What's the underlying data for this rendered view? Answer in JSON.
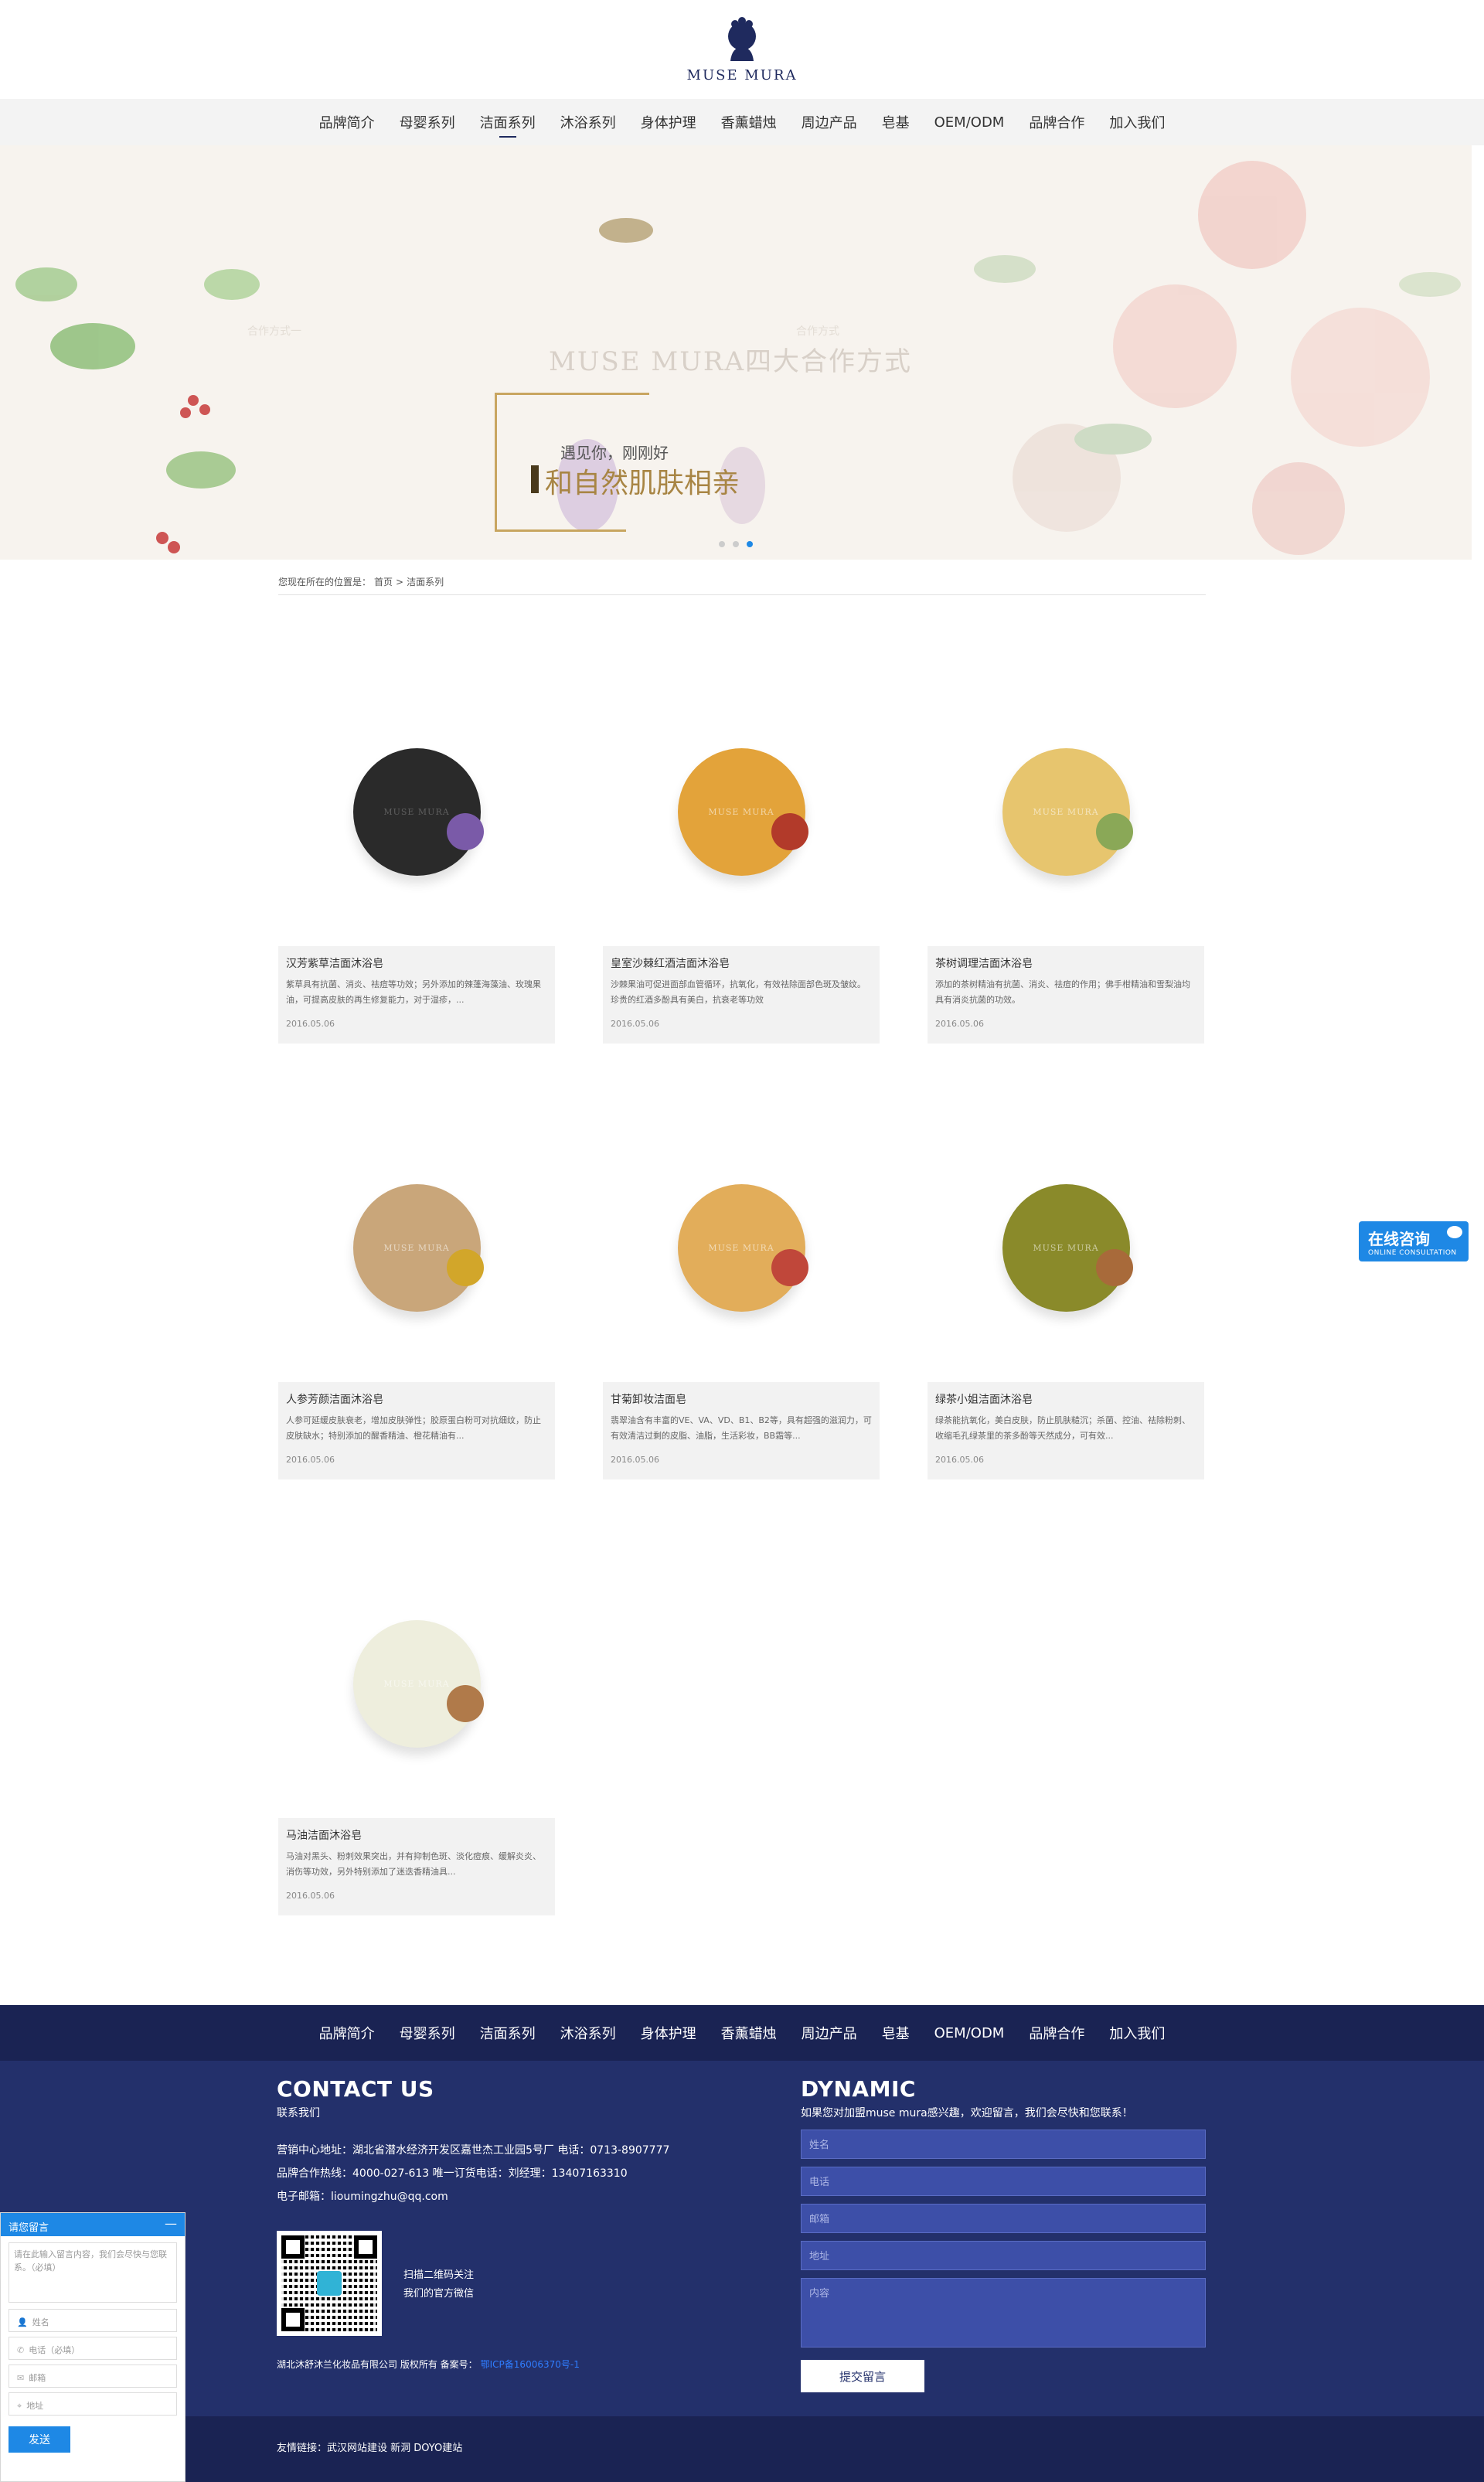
{
  "brand": {
    "logo_text": "MUSE MURA"
  },
  "nav": [
    "品牌简介",
    "母婴系列",
    "洁面系列",
    "沐浴系列",
    "身体护理",
    "香薰蜡烛",
    "周边产品",
    "皂基",
    "OEM/ODM",
    "品牌合作",
    "加入我们"
  ],
  "nav_active_index": 2,
  "banner": {
    "watermark_title": "MUSE MURA四大合作方式",
    "slogan_line1": "遇见你，刚刚好",
    "slogan_line2": "和自然肌肤相亲",
    "ghost_left": "合作方式一",
    "ghost_right": "合作方式"
  },
  "breadcrumb": {
    "prefix": "您现在所在的位置是：",
    "home": "首页",
    "sep": ">",
    "current": "洁面系列"
  },
  "products": [
    {
      "title": "汉芳紫草洁面沐浴皂",
      "desc": "紫草具有抗菌、消炎、祛痘等功效；另外添加的辣蓬海藻油、玫瑰果油，可提高皮肤的再生修复能力，对于湿疹，...",
      "date": "2016.05.06",
      "soap_color": "#2a2a2a",
      "herb_color": "#7a5aa8"
    },
    {
      "title": "皇室沙棘红酒洁面沐浴皂",
      "desc": "沙棘果油可促进面部血管循环，抗氧化，有效祛除面部色斑及皱纹。珍贵的红酒多酚具有美白，抗衰老等功效",
      "date": "2016.05.06",
      "soap_color": "#e3a33a",
      "herb_color": "#b23a2a"
    },
    {
      "title": "茶树调理洁面沐浴皂",
      "desc": "添加的茶树精油有抗菌、消炎、祛痘的作用；佛手柑精油和雪梨油均具有消炎抗菌的功效。",
      "date": "2016.05.06",
      "soap_color": "#e7c56e",
      "herb_color": "#8aa857"
    },
    {
      "title": "人参芳颜洁面沐浴皂",
      "desc": "人参可延缓皮肤衰老，增加皮肤弹性；胶原蛋白粉可对抗细纹，防止皮肤缺水；特别添加的醒香精油、橙花精油有...",
      "date": "2016.05.06",
      "soap_color": "#c9a67a",
      "herb_color": "#d2a62a"
    },
    {
      "title": "甘菊卸妆洁面皂",
      "desc": "翡翠油含有丰富的VE、VA、VD、B1、B2等，具有超强的滋润力，可有效清洁过剩的皮脂、油脂，生活彩妆，BB霜等...",
      "date": "2016.05.06",
      "soap_color": "#e2ad5a",
      "herb_color": "#c0473a"
    },
    {
      "title": "绿茶小姐洁面沐浴皂",
      "desc": "绿茶能抗氧化，美白皮肤，防止肌肤糙沉；杀菌、控油、祛除粉刺、收缩毛孔绿茶里的茶多酚等天然成分，可有效...",
      "date": "2016.05.06",
      "soap_color": "#8a8a2a",
      "herb_color": "#a86a3a"
    },
    {
      "title": "马油洁面沐浴皂",
      "desc": "马油对黑头、粉刺效果突出，并有抑制色斑、淡化痘痕、缓解炎炎、消伤等功效，另外特别添加了迷迭香精油具...",
      "date": "2016.05.06",
      "soap_color": "#eeeedd",
      "herb_color": "#b07a4a"
    }
  ],
  "consult": {
    "title": "在线咨询",
    "sub": "ONLINE CONSULTATION"
  },
  "footer": {
    "contact_title": "CONTACT US",
    "contact_sub": "联系我们",
    "lines": [
      "营销中心地址：湖北省潜水经济开发区嘉世杰工业园5号厂    电话：0713-8907777",
      "品牌合作热线：4000-027-613    唯一订货电话：刘经理：13407163310",
      "电子邮箱：lioumingzhu@qq.com"
    ],
    "qr_text": [
      "扫描二维码关注",
      "我们的官方微信"
    ],
    "copyright": "湖北沐舒沐兰化妆品有限公司 版权所有       备案号：",
    "record_link": "鄂ICP备16006370号-1",
    "dynamic_title": "DYNAMIC",
    "dynamic_sub": "如果您对加盟muse mura感兴趣，欢迎留言，我们会尽快和您联系！",
    "placeholders": [
      "姓名",
      "电话",
      "邮箱",
      "地址",
      "内容"
    ],
    "submit": "提交留言",
    "links": "友情链接：武汉网站建设  新洞  DOYO建站"
  },
  "message_widget": {
    "title": "请您留言",
    "minimize": "—",
    "textarea_placeholder": "请在此输入留言内容，我们会尽快与您联系。（必填）",
    "fields": [
      {
        "icon": "user-icon",
        "glyph": "👤",
        "label": "姓名"
      },
      {
        "icon": "phone-icon",
        "glyph": "✆",
        "label": "电话（必填）"
      },
      {
        "icon": "mail-icon",
        "glyph": "✉",
        "label": "邮箱"
      },
      {
        "icon": "location-icon",
        "glyph": "⌖",
        "label": "地址"
      }
    ],
    "send": "发送"
  }
}
